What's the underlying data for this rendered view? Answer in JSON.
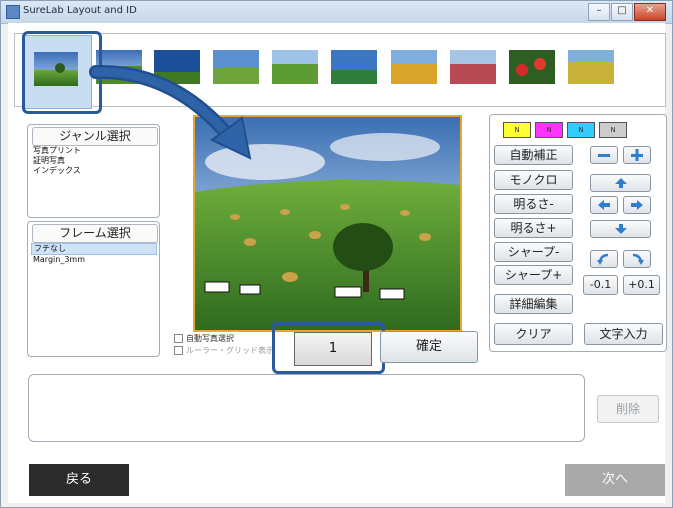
{
  "window": {
    "title": "SureLab Layout and ID"
  },
  "genre": {
    "title": "ジャンル選択",
    "items": [
      "写真プリント",
      "証明写真",
      "インデックス"
    ]
  },
  "frame": {
    "title": "フレーム選択",
    "items": [
      "フチなし",
      "Margin_3mm"
    ],
    "selected_index": 0
  },
  "options": {
    "auto_select": "自動写真選択",
    "ruler_grid": "ルーラー・グリッド表示"
  },
  "controls": {
    "count_value": "1",
    "confirm": "確定"
  },
  "color_swatches": [
    {
      "label": "N",
      "color": "#ffff33"
    },
    {
      "label": "N",
      "color": "#ff33ff"
    },
    {
      "label": "N",
      "color": "#33ccff"
    },
    {
      "label": "N",
      "color": "#cccccc"
    }
  ],
  "edit_buttons": {
    "auto_correct": "自動補正",
    "mono": "モノクロ",
    "darker": "明るさ-",
    "brighter": "明るさ+",
    "sharp_minus": "シャープ-",
    "sharp_plus": "シャープ+",
    "detail_edit": "詳細編集",
    "clear": "クリア",
    "text_input": "文字入力",
    "rot_minus": "-0.1",
    "rot_plus": "+0.1"
  },
  "bottom": {
    "delete": "削除",
    "back": "戻る",
    "next": "次へ"
  }
}
